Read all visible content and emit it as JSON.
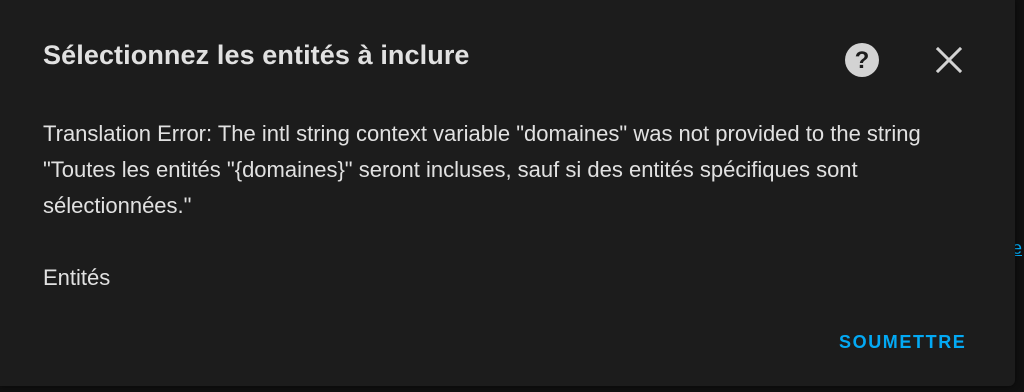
{
  "dialog": {
    "title": "Sélectionnez les entités à inclure",
    "help_icon": "help-circle-icon",
    "close_icon": "close-icon",
    "message": "Translation Error: The intl string context variable \"domaines\" was not provided to the string \"Toutes les entités \"{domaines}\" seront incluses, sauf si des entités spécifiques sont sélectionnées.\"",
    "entities_label": "Entités",
    "submit_label": "SOUMETTRE"
  },
  "colors": {
    "dialog_bg": "#1c1c1c",
    "text": "#e1e1e1",
    "accent": "#03a9f4",
    "icon": "#d3d3d3"
  }
}
